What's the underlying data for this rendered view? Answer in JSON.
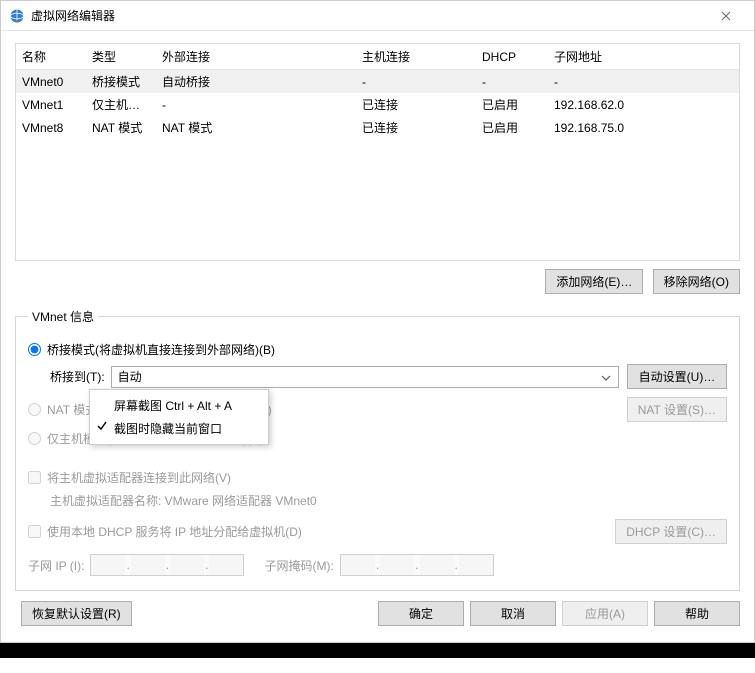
{
  "title": "虚拟网络编辑器",
  "table": {
    "headers": {
      "name": "名称",
      "type": "类型",
      "ext": "外部连接",
      "host": "主机连接",
      "dhcp": "DHCP",
      "subnet": "子网地址"
    },
    "rows": [
      {
        "name": "VMnet0",
        "type": "桥接模式",
        "ext": "自动桥接",
        "host": "-",
        "dhcp": "-",
        "subnet": "-"
      },
      {
        "name": "VMnet1",
        "type": "仅主机…",
        "ext": "-",
        "host": "已连接",
        "dhcp": "已启用",
        "subnet": "192.168.62.0"
      },
      {
        "name": "VMnet8",
        "type": "NAT 模式",
        "ext": "NAT 模式",
        "host": "已连接",
        "dhcp": "已启用",
        "subnet": "192.168.75.0"
      }
    ]
  },
  "buttons": {
    "add_network": "添加网络(E)…",
    "remove_network": "移除网络(O)",
    "restore_defaults": "恢复默认设置(R)",
    "ok": "确定",
    "cancel": "取消",
    "apply": "应用(A)",
    "help": "帮助",
    "auto_settings": "自动设置(U)…",
    "nat_settings": "NAT 设置(S)…",
    "dhcp_settings": "DHCP 设置(C)…"
  },
  "group": {
    "legend": "VMnet 信息",
    "opt_bridge": "桥接模式(将虚拟机直接连接到外部网络)(B)",
    "bridge_to_label": "桥接到(T):",
    "bridge_to_value": "自动",
    "opt_nat": "NAT 模式(与虚拟机共享主机的 IP 地址)(N)",
    "opt_hostonly": "仅主机模式(在专用网络内连接虚拟机)(H)",
    "chk_host_adapter": "将主机虚拟适配器连接到此网络(V)",
    "host_adapter_name": "主机虚拟适配器名称: VMware 网络适配器 VMnet0",
    "chk_dhcp": "使用本地 DHCP 服务将 IP 地址分配给虚拟机(D)",
    "subnet_ip_label": "子网 IP (I):",
    "subnet_mask_label": "子网掩码(M):"
  },
  "context_menu": {
    "item1": "屏幕截图 Ctrl + Alt + A",
    "item2": "截图时隐藏当前窗口"
  }
}
